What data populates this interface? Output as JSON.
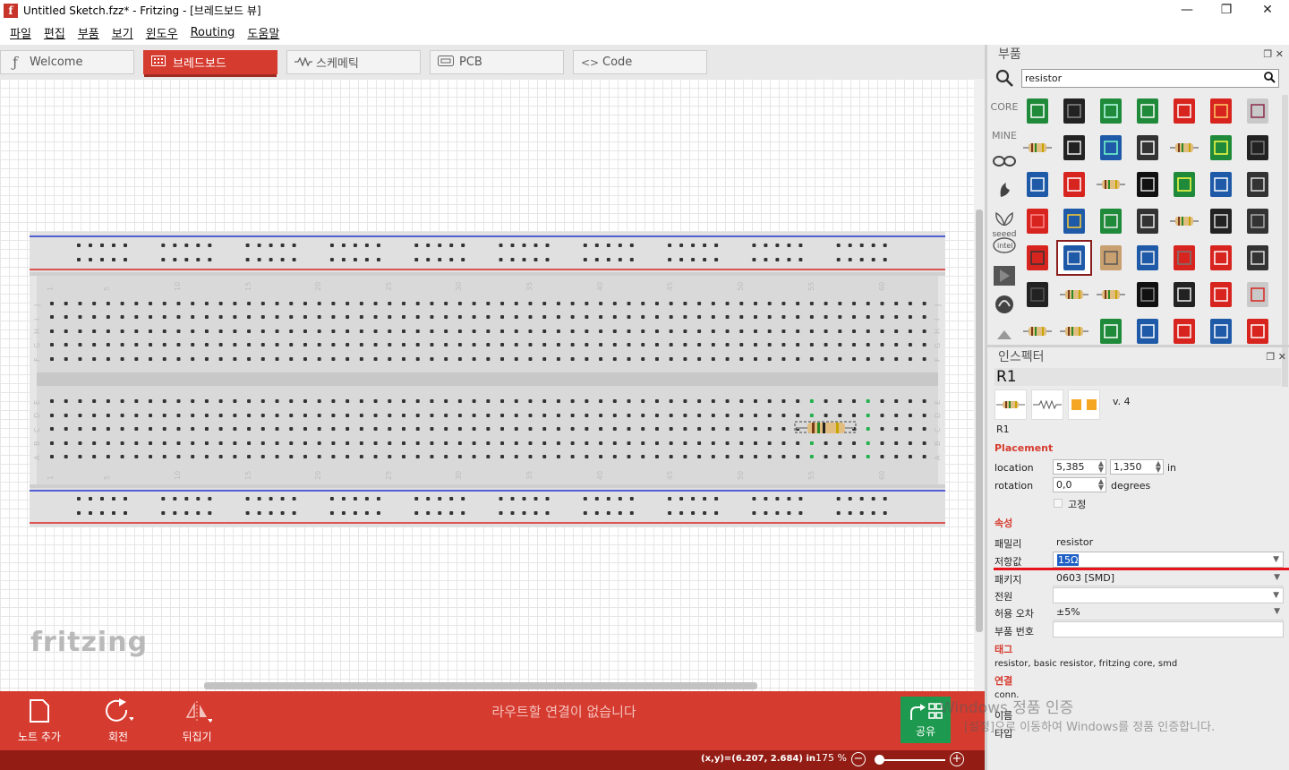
{
  "window": {
    "title": "Untitled Sketch.fzz* - Fritzing - [브레드보드 뷰]",
    "app_icon": "f",
    "minimize": "—",
    "maximize": "❐",
    "close": "✕"
  },
  "menu": [
    "파일",
    "편집",
    "부품",
    "보기",
    "윈도우",
    "Routing",
    "도움말"
  ],
  "tabs": [
    {
      "label": "Welcome",
      "icon": "fritzing-icon",
      "active": false
    },
    {
      "label": "브레드보드",
      "icon": "breadboard-icon",
      "active": true
    },
    {
      "label": "스케메틱",
      "icon": "schematic-icon",
      "active": false
    },
    {
      "label": "PCB",
      "icon": "pcb-icon",
      "active": false
    },
    {
      "label": "Code",
      "icon": "code-icon",
      "active": false
    }
  ],
  "canvas": {
    "logo": "fritzing",
    "breadboard_col_numbers": [
      "1",
      "5",
      "10",
      "15",
      "20",
      "25",
      "30",
      "35",
      "40",
      "45",
      "50",
      "55",
      "60"
    ],
    "breadboard_rows_top": [
      "J",
      "I",
      "H",
      "G",
      "F"
    ],
    "breadboard_rows_bottom": [
      "E",
      "D",
      "C",
      "B",
      "A"
    ]
  },
  "toolbar": {
    "add_note": "노트 추가",
    "rotate": "회전",
    "flip": "뒤집기",
    "routing_status": "라우트할 연결이 없습니다",
    "share": "공유"
  },
  "statusbar": {
    "coords": "(x,y)=(6.207, 2.684) in",
    "zoom": "175 %",
    "zoom_out": "−",
    "zoom_in": "+",
    "zoom_level_fraction": 0.0
  },
  "parts_panel": {
    "title": "부품",
    "search_value": "resistor",
    "bins": [
      "CORE",
      "MINE",
      "arduino-bin",
      "sparkfun-bin",
      "seeed",
      "intel",
      "contrib-bin",
      "temp-bin",
      "scroll-up"
    ],
    "selected_part_index": 29
  },
  "inspector": {
    "title": "인스펙터",
    "part_title": "R1",
    "version": "v. 4",
    "part_label": "R1",
    "placement_label": "Placement",
    "location_label": "location",
    "location_x": "5,385",
    "location_y": "1,350",
    "location_unit": "in",
    "rotation_label": "rotation",
    "rotation_value": "0,0",
    "rotation_unit": "degrees",
    "locked_label": "고정",
    "properties_label": "속성",
    "family_label": "패밀리",
    "family_value": "resistor",
    "resistance_label": "저항값",
    "resistance_value": "15Ω",
    "package_label": "패키지",
    "package_value": "0603 [SMD]",
    "power_label": "전원",
    "power_value": "",
    "tolerance_label": "허용 오차",
    "tolerance_value": "±5%",
    "partnumber_label": "부품 번호",
    "partnumber_value": "",
    "tags_label": "태그",
    "tags_value": "resistor, basic resistor, fritzing core, smd",
    "connections_label": "연결",
    "conn_label": "conn.",
    "name_label": "이름",
    "type_label": "타입"
  },
  "windows_activation": {
    "line1": "Windows 정품 인증",
    "line2": "[설정]으로 이동하여 Windows를 정품 인증합니다."
  },
  "colors": {
    "accent": "#d63b2f",
    "statusbar": "#931d14",
    "share": "#1d9a4f",
    "rail_blue": "#2233cc",
    "rail_red": "#dd2222"
  }
}
